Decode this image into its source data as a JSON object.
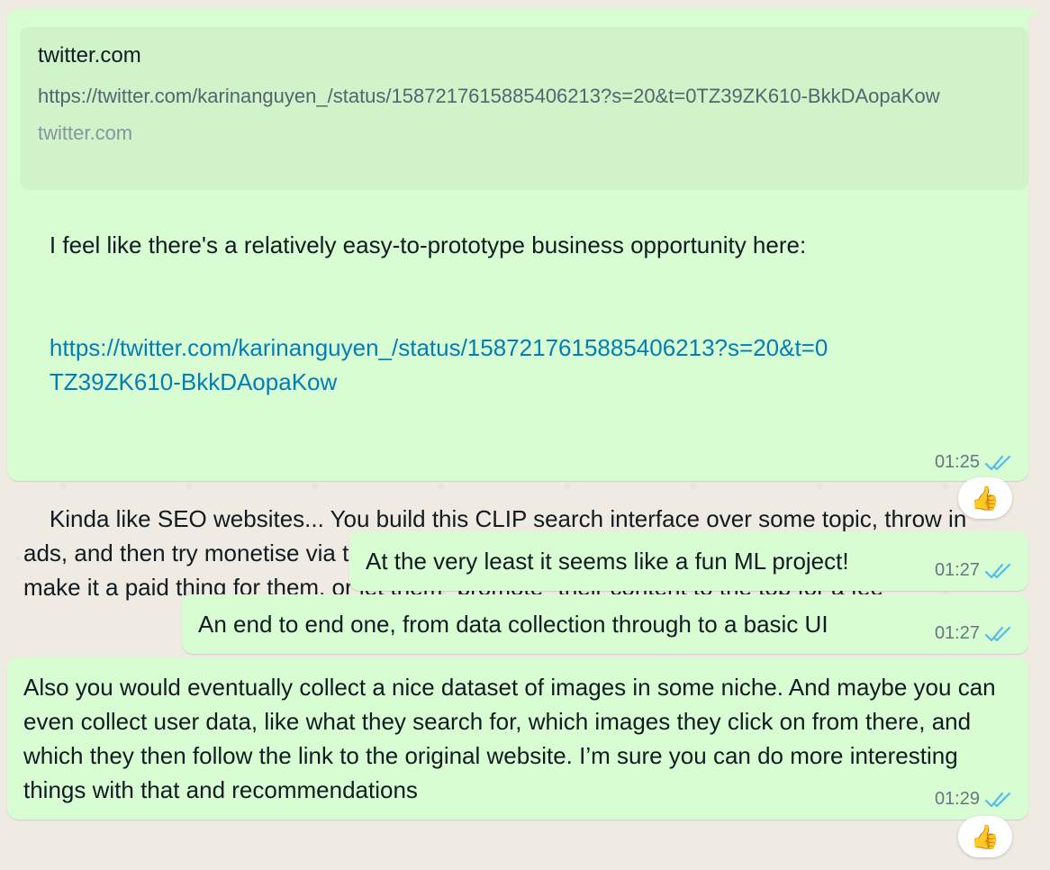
{
  "preview": {
    "title": "twitter.com",
    "description": "https://twitter.com/karinanguyen_/status/1587217615885406213?s=20&t=0TZ39ZK610-BkkDAopaKow",
    "domain": "twitter.com"
  },
  "messages": [
    {
      "text_before_link": "I feel like there's a relatively easy-to-prototype business opportunity here:",
      "link": "https://twitter.com/karinanguyen_/status/1587217615885406213?s=20&t=0TZ39ZK610-BkkDAopaKow",
      "text_after_link": "Kinda like SEO websites... You build this CLIP search interface over some topic, throw in ads, and then try monetise via the companies you link out to. Could do affiliate links, could even make it a paid thing for them, or let them \"promote\" their content to the top for a fee",
      "time": "01:25",
      "reaction": "👍"
    },
    {
      "text": "At the very least it seems like a fun ML project!",
      "time": "01:27"
    },
    {
      "text": "An end to end one, from data collection through to a basic UI",
      "time": "01:27"
    },
    {
      "text": "Also you would eventually collect a nice dataset of images in some niche. And maybe you can even collect user data, like what they search for, which images they click on from there, and which they then follow the link to the original website. I’m sure you can do more interesting things with that and recommendations",
      "time": "01:29",
      "reaction": "👍"
    }
  ],
  "colors": {
    "bubble_out": "#d9fdd3",
    "link": "#027eb5",
    "read_ticks": "#53bdeb",
    "meta_text": "#667781",
    "background": "#efeae2"
  },
  "icons": {
    "read_receipt": "double-check-icon",
    "reaction": "thumbs-up-icon"
  }
}
